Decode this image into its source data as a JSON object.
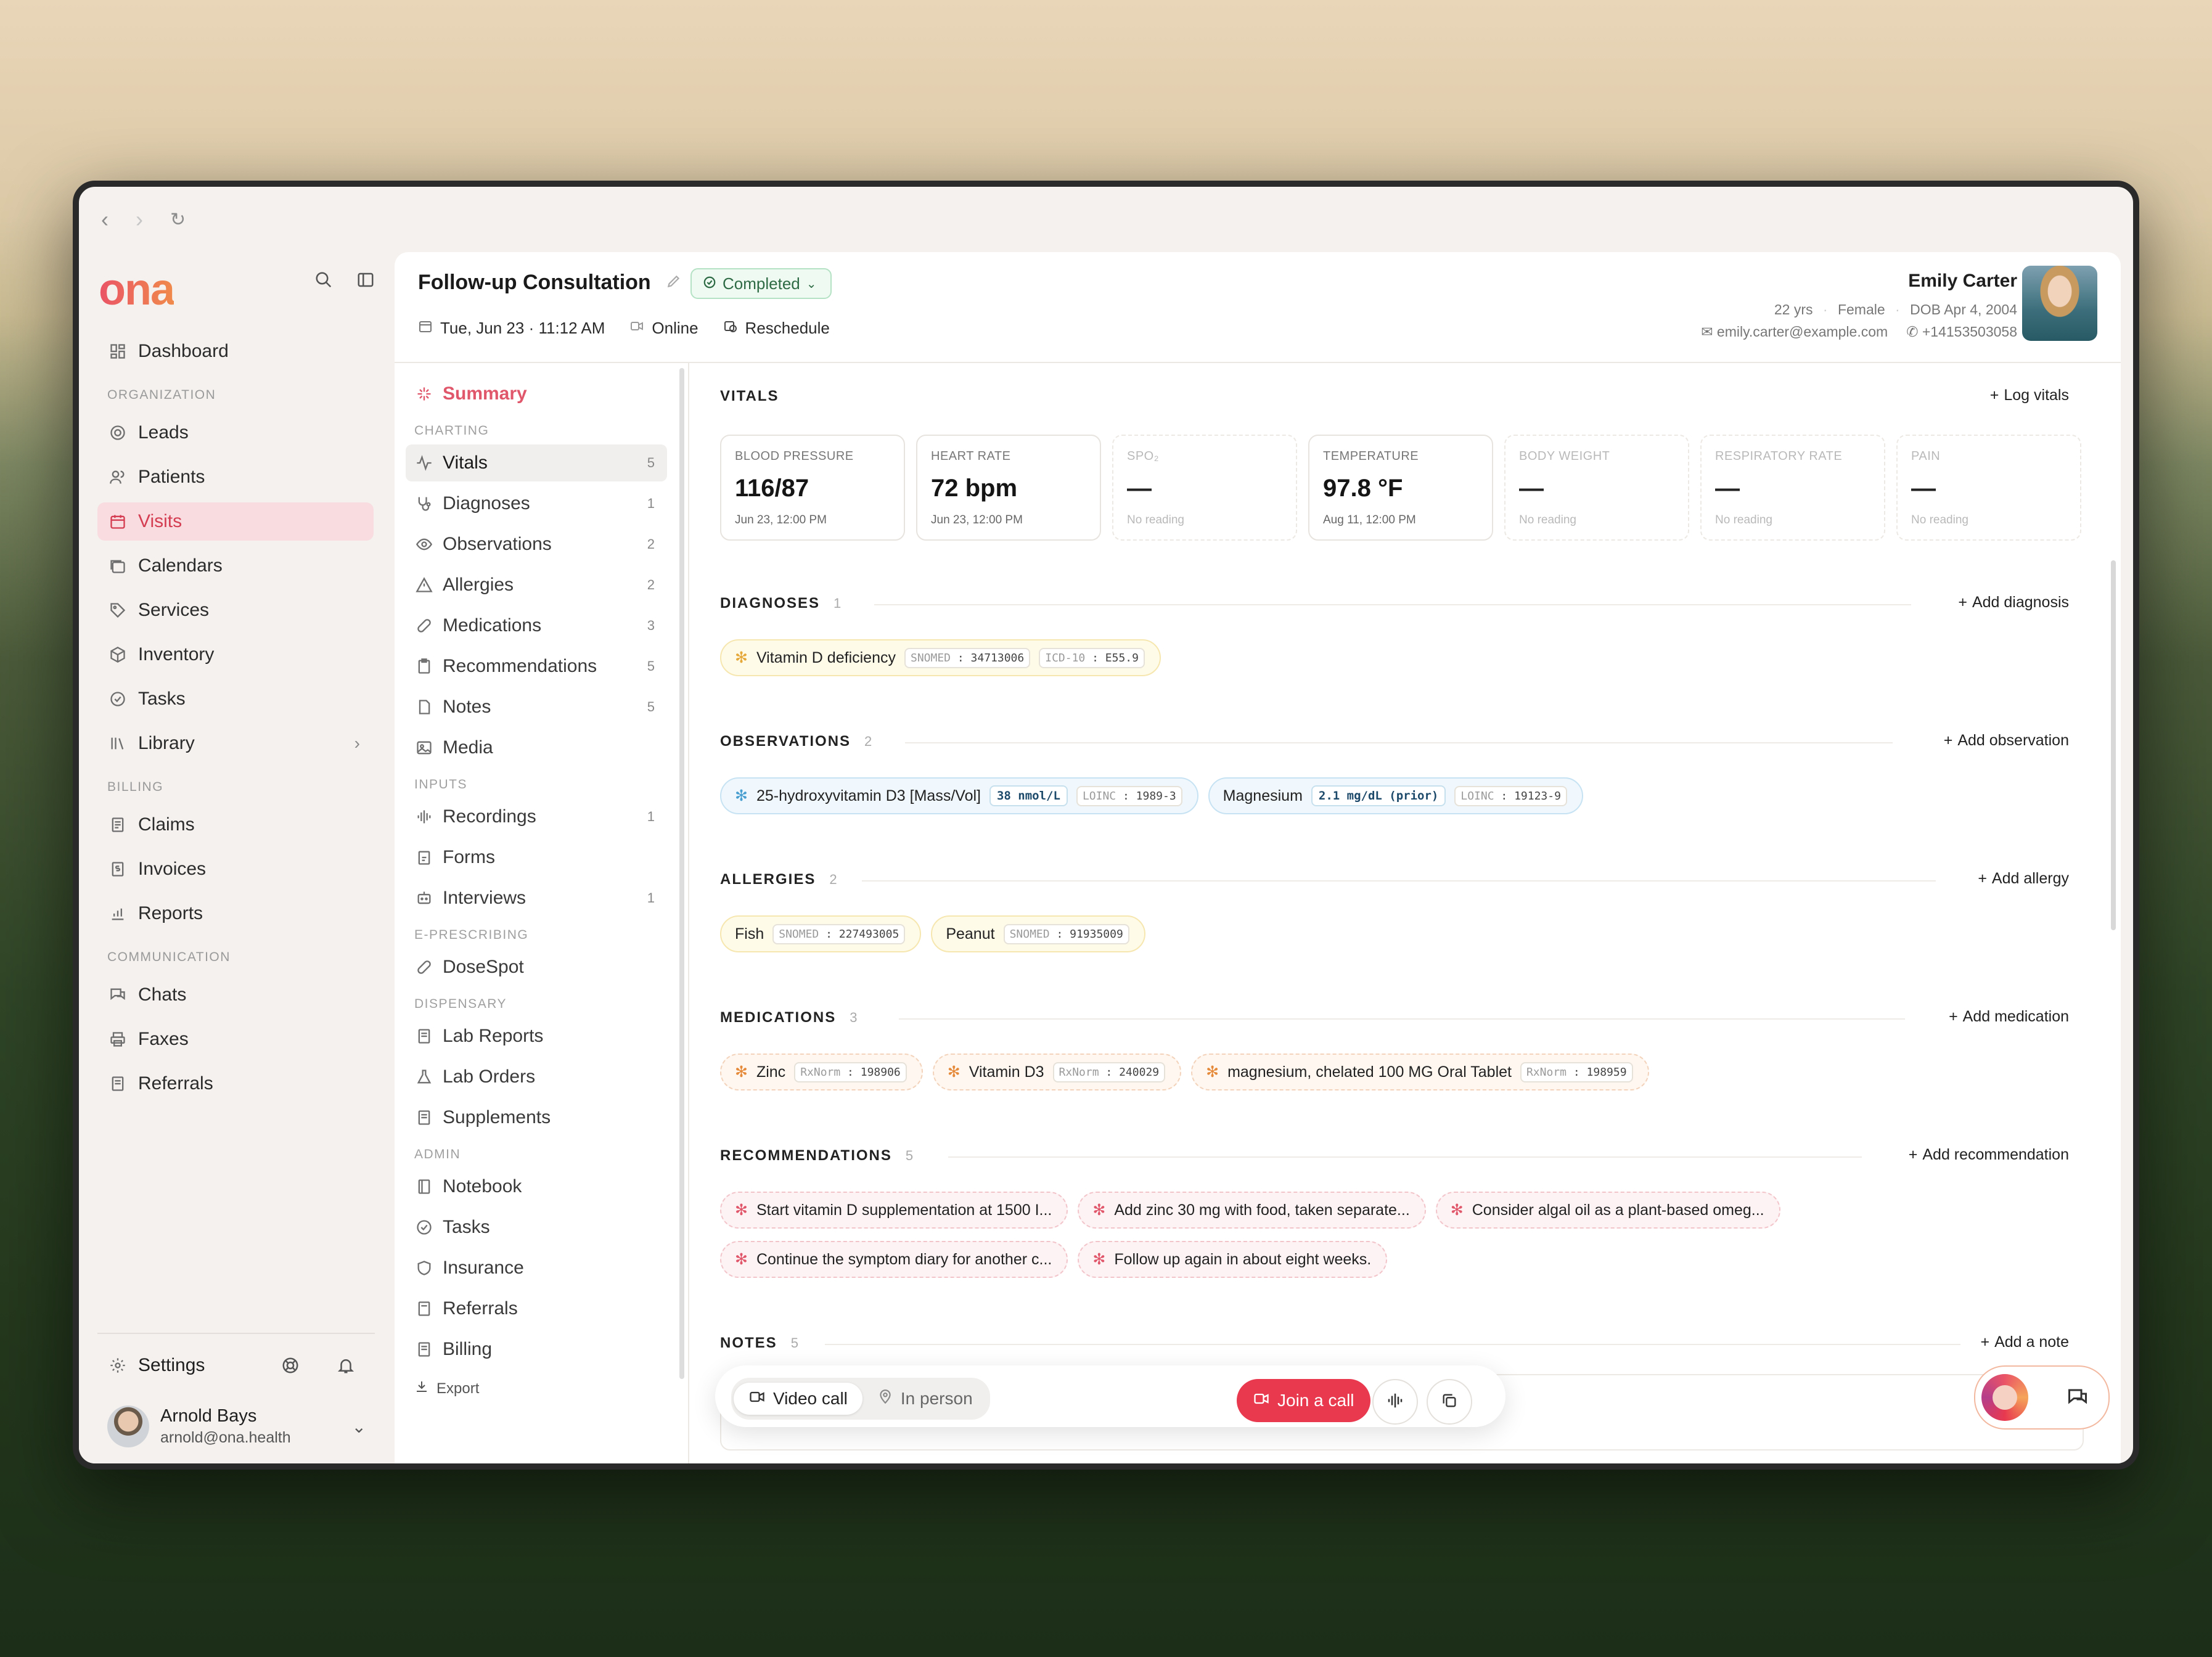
{
  "sidebar": {
    "logo": "ona",
    "dashboard": "Dashboard",
    "sections": {
      "organization": "ORGANIZATION",
      "billing": "BILLING",
      "communication": "COMMUNICATION"
    },
    "org_items": [
      "Leads",
      "Patients",
      "Visits",
      "Calendars",
      "Services",
      "Inventory",
      "Tasks",
      "Library"
    ],
    "billing_items": [
      "Claims",
      "Invoices",
      "Reports"
    ],
    "comm_items": [
      "Chats",
      "Faxes",
      "Referrals"
    ],
    "settings": "Settings",
    "user": {
      "name": "Arnold Bays",
      "email": "arnold@ona.health"
    }
  },
  "visit": {
    "title": "Follow-up Consultation",
    "status": "Completed",
    "datetime": "Tue, Jun 23 · 11:12 AM",
    "mode": "Online",
    "reschedule": "Reschedule"
  },
  "patient": {
    "name": "Emily Carter",
    "age": "22 yrs",
    "sex": "Female",
    "dob": "DOB Apr 4, 2004",
    "email": "emily.carter@example.com",
    "phone": "+14153503058"
  },
  "subnav": {
    "summary": "Summary",
    "sections": {
      "charting": "CHARTING",
      "inputs": "INPUTS",
      "eprescribing": "E-PRESCRIBING",
      "dispensary": "DISPENSARY",
      "admin": "ADMIN"
    },
    "charting": [
      {
        "label": "Vitals",
        "count": "5"
      },
      {
        "label": "Diagnoses",
        "count": "1"
      },
      {
        "label": "Observations",
        "count": "2"
      },
      {
        "label": "Allergies",
        "count": "2"
      },
      {
        "label": "Medications",
        "count": "3"
      },
      {
        "label": "Recommendations",
        "count": "5"
      },
      {
        "label": "Notes",
        "count": "5"
      },
      {
        "label": "Media",
        "count": ""
      }
    ],
    "inputs": [
      {
        "label": "Recordings",
        "count": "1"
      },
      {
        "label": "Forms",
        "count": ""
      },
      {
        "label": "Interviews",
        "count": "1"
      }
    ],
    "eprescribing": [
      {
        "label": "DoseSpot"
      }
    ],
    "dispensary": [
      {
        "label": "Lab Reports"
      },
      {
        "label": "Lab Orders"
      },
      {
        "label": "Supplements"
      }
    ],
    "admin": [
      {
        "label": "Notebook"
      },
      {
        "label": "Tasks"
      },
      {
        "label": "Insurance"
      },
      {
        "label": "Referrals"
      },
      {
        "label": "Billing"
      }
    ],
    "export": "Export"
  },
  "vitals": {
    "title": "VITALS",
    "action": "Log vitals",
    "cards": [
      {
        "label": "BLOOD PRESSURE",
        "value": "116/87",
        "sub": "Jun 23, 12:00 PM"
      },
      {
        "label": "HEART RATE",
        "value": "72 bpm",
        "sub": "Jun 23, 12:00 PM"
      },
      {
        "label": "SPO₂",
        "value": "—",
        "sub": "No reading"
      },
      {
        "label": "TEMPERATURE",
        "value": "97.8 °F",
        "sub": "Aug 11, 12:00 PM"
      },
      {
        "label": "BODY WEIGHT",
        "value": "—",
        "sub": "No reading"
      },
      {
        "label": "RESPIRATORY RATE",
        "value": "—",
        "sub": "No reading"
      },
      {
        "label": "PAIN",
        "value": "—",
        "sub": "No reading"
      }
    ]
  },
  "diagnoses": {
    "title": "DIAGNOSES",
    "count": "1",
    "action": "Add diagnosis",
    "items": [
      {
        "label": "Vitamin D deficiency",
        "code1_key": "SNOMED",
        "code1_val": "34713006",
        "code2_key": "ICD-10",
        "code2_val": "E55.9"
      }
    ]
  },
  "observations": {
    "title": "OBSERVATIONS",
    "count": "2",
    "action": "Add observation",
    "items": [
      {
        "label": "25-hydroxyvitamin D3 [Mass/Vol]",
        "value": "38 nmol/L",
        "code_key": "LOINC",
        "code_val": "1989-3"
      },
      {
        "label": "Magnesium",
        "value": "2.1 mg/dL (prior)",
        "code_key": "LOINC",
        "code_val": "19123-9"
      }
    ]
  },
  "allergies": {
    "title": "ALLERGIES",
    "count": "2",
    "action": "Add allergy",
    "items": [
      {
        "label": "Fish",
        "code_key": "SNOMED",
        "code_val": "227493005"
      },
      {
        "label": "Peanut",
        "code_key": "SNOMED",
        "code_val": "91935009"
      }
    ]
  },
  "medications": {
    "title": "MEDICATIONS",
    "count": "3",
    "action": "Add medication",
    "items": [
      {
        "label": "Zinc",
        "code_key": "RxNorm",
        "code_val": "198906"
      },
      {
        "label": "Vitamin D3",
        "code_key": "RxNorm",
        "code_val": "240029"
      },
      {
        "label": "magnesium, chelated 100 MG Oral Tablet",
        "code_key": "RxNorm",
        "code_val": "198959"
      }
    ]
  },
  "recommendations": {
    "title": "RECOMMENDATIONS",
    "count": "5",
    "action": "Add recommendation",
    "items": [
      "Start vitamin D supplementation at 1500 I...",
      "Add zinc 30 mg with food, taken separate...",
      "Consider algal oil as a plant-based omeg...",
      "Continue the symptom diary for another c...",
      "Follow up again in about eight weeks."
    ]
  },
  "notes": {
    "title": "NOTES",
    "count": "5",
    "action": "Add a note"
  },
  "callbar": {
    "video": "Video call",
    "inperson": "In person",
    "join": "Join a call"
  },
  "colors": {
    "accent": "#e8394f",
    "active_nav_bg": "#f8dcdf",
    "status_green": "#2e6b45"
  }
}
